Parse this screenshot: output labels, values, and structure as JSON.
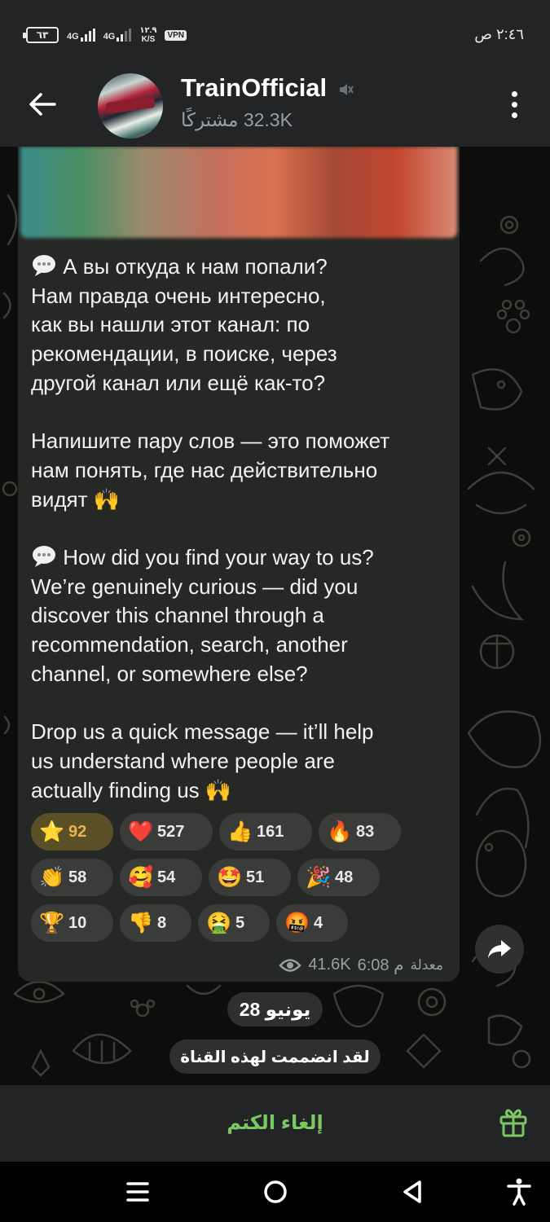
{
  "status_bar": {
    "battery": "٦٣",
    "signal_1": "4G",
    "signal_2": "4G",
    "speed_value": "١٢.٩",
    "speed_unit": "K/S",
    "vpn": "VPN",
    "time": "٢:٤٦ ص"
  },
  "header": {
    "title": "TrainOfficial",
    "subscribers": "32.3K مشتركًا"
  },
  "message": {
    "lines": [
      "А вы откуда к нам попали?",
      "Нам правда очень интересно,",
      "как вы нашли этот канал: по",
      "рекомендации, в поиске, через",
      "другой канал или ещё как-то?",
      "",
      "Напишите пару слов — это поможет",
      "нам понять, где нас действительно",
      "видят",
      "",
      "How did you find your way to us?",
      "We’re genuinely curious — did you",
      "discover this channel through a",
      "recommendation, search, another",
      "channel, or somewhere else?",
      "",
      "Drop us a quick message — it’ll help",
      "us understand where people are",
      "actually finding us"
    ],
    "views": "41.6K",
    "time": "م 6:08",
    "edited": "معدلة"
  },
  "reactions": [
    [
      {
        "emoji": "⭐",
        "count": "92"
      },
      {
        "emoji": "❤️",
        "count": "527"
      },
      {
        "emoji": "👍",
        "count": "161"
      },
      {
        "emoji": "🔥",
        "count": "83"
      }
    ],
    [
      {
        "emoji": "👏",
        "count": "58"
      },
      {
        "emoji": "🥰",
        "count": "54"
      },
      {
        "emoji": "🤩",
        "count": "51"
      },
      {
        "emoji": "🎉",
        "count": "48"
      }
    ],
    [
      {
        "emoji": "🏆",
        "count": "10"
      },
      {
        "emoji": "👎",
        "count": "8"
      },
      {
        "emoji": "🤮",
        "count": "5"
      },
      {
        "emoji": "🤬",
        "count": "4"
      }
    ]
  ],
  "date_pill": "28 يونيو",
  "service_message": "لقد انضممت لهذه القناة",
  "bottom": {
    "unmute_label": "إلغاء الكتم"
  },
  "icons": {
    "back": "back-arrow-icon",
    "mute": "muted-speaker-icon",
    "more": "more-vertical-icon",
    "views": "eye-icon",
    "share": "share-arrow-icon",
    "gift": "gift-icon"
  },
  "colors": {
    "header_bg": "#222425",
    "bubble_bg": "#262826",
    "accent_green": "#7bc862",
    "active_reaction_bg": "#5b4f28",
    "active_reaction_text": "#e7b54a"
  }
}
